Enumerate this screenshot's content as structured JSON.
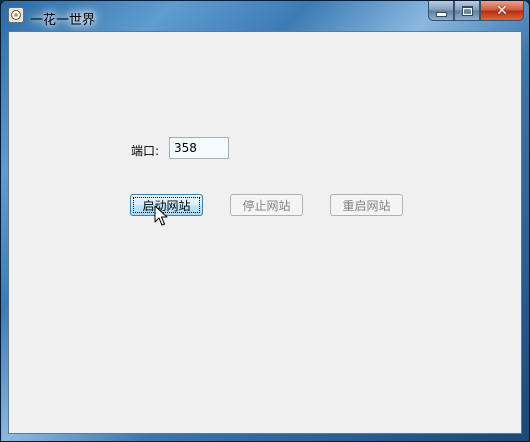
{
  "window": {
    "title": "一花一世界"
  },
  "form": {
    "port_label": "端口:",
    "port_value": "358"
  },
  "buttons": {
    "start_label": "启动网站",
    "stop_label": "停止网站",
    "restart_label": "重启网站"
  },
  "colors": {
    "client_background": "#f0f0f0",
    "close_button": "#c2391f",
    "start_button_border": "#3c7fb1"
  }
}
